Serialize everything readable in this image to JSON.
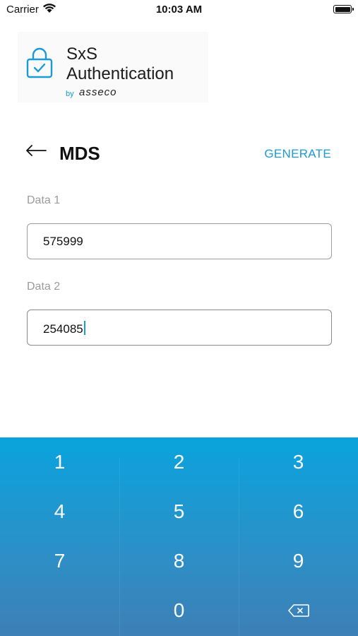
{
  "status_bar": {
    "carrier": "Carrier",
    "time": "10:03 AM"
  },
  "logo": {
    "title_line1": "SxS",
    "title_line2": "Authentication",
    "by": "by",
    "brand": "asseco"
  },
  "header": {
    "title": "MDS",
    "generate_label": "GENERATE"
  },
  "fields": [
    {
      "label": "Data 1",
      "value": "575999"
    },
    {
      "label": "Data 2",
      "value": "254085"
    }
  ],
  "keypad": {
    "keys": [
      "1",
      "2",
      "3",
      "4",
      "5",
      "6",
      "7",
      "8",
      "9",
      "",
      "0",
      "backspace"
    ]
  },
  "colors": {
    "accent": "#1a9ad6",
    "keypad_top": "#0aa3dd",
    "keypad_bottom": "#3d7fb7"
  }
}
